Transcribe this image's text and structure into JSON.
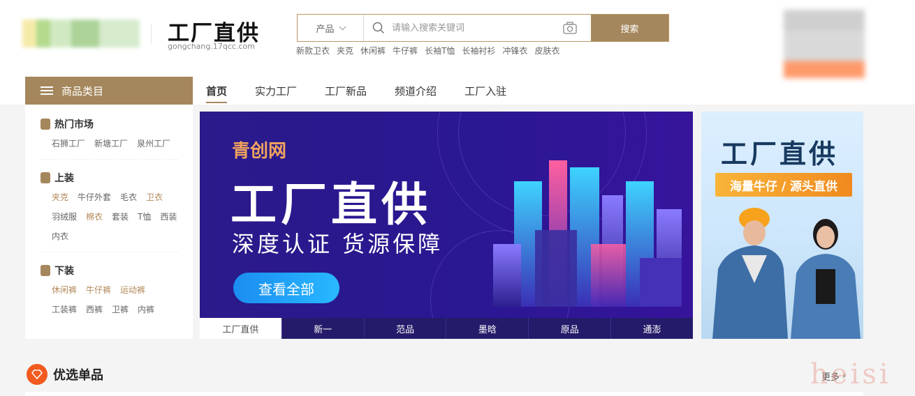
{
  "header": {
    "site_title": "工厂直供",
    "site_subtitle": "gongchang.17qcc.com",
    "search": {
      "category": "产品",
      "placeholder": "请输入搜索关键词",
      "button": "搜索"
    },
    "hot_words": [
      "新款卫衣",
      "夹克",
      "休闲裤",
      "牛仔裤",
      "长袖T恤",
      "长袖衬衫",
      "冲锋衣",
      "皮肤衣"
    ]
  },
  "category_menu": {
    "label": "商品类目"
  },
  "nav": [
    "首页",
    "实力工厂",
    "工厂新品",
    "频道介绍",
    "工厂入驻"
  ],
  "sidebar": {
    "sections": [
      {
        "title": "热门市场",
        "links": [
          {
            "t": "石狮工厂"
          },
          {
            "t": "新塘工厂"
          },
          {
            "t": "泉州工厂"
          }
        ]
      },
      {
        "title": "上装",
        "links": [
          {
            "t": "夹克",
            "hl": true
          },
          {
            "t": "牛仔外套"
          },
          {
            "t": "毛衣"
          },
          {
            "t": "卫衣",
            "hl": true
          },
          {
            "t": "羽绒服"
          },
          {
            "t": "棉衣",
            "hl": true
          },
          {
            "t": "套装"
          },
          {
            "t": "T恤"
          },
          {
            "t": "西装"
          },
          {
            "t": "内衣"
          }
        ]
      },
      {
        "title": "下装",
        "links": [
          {
            "t": "休闲裤",
            "hl": true
          },
          {
            "t": "牛仔裤",
            "hl": true
          },
          {
            "t": "运动裤",
            "hl": true
          },
          {
            "t": "工装裤"
          },
          {
            "t": "西裤"
          },
          {
            "t": "卫裤"
          },
          {
            "t": "内裤"
          }
        ]
      }
    ]
  },
  "banner": {
    "brand": "青创网",
    "headline": "工厂直供",
    "slogan": "深度认证 货源保障",
    "cta": "查看全部"
  },
  "banner_tabs": [
    "工厂直供",
    "新一",
    "范品",
    "墨晗",
    "原品",
    "通澎"
  ],
  "side_ad": {
    "title": "工厂直供",
    "tag": "海量牛仔 / 源头直供"
  },
  "section": {
    "title": "优选单品",
    "more": "更多"
  },
  "watermark": "heisi",
  "colors": {
    "accent": "#a5875d",
    "banner_bg": "#2a1a8a",
    "tab_bg": "#241c6a"
  }
}
